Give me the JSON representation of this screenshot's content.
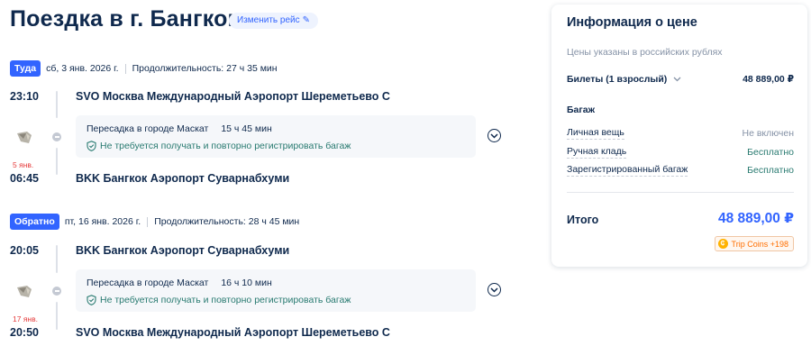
{
  "title": "Поездка в г. Бангкок",
  "change_label": "Изменить рейс",
  "outbound": {
    "badge": "Туда",
    "date": "сб, 3 янв. 2026 г.",
    "duration": "Продолжительность: 27 ч 35 мин",
    "depart_time": "23:10",
    "depart_airport": "SVO Москва Международный Аэропорт Шереметьево C",
    "transfer_city": "Пересадка в городе Маскат",
    "transfer_duration": "15 ч 45 мин",
    "baggage_note": "Не требуется получать и повторно регистрировать багаж",
    "arrive_day": "5 янв.",
    "arrive_time": "06:45",
    "arrive_airport": "BKK Бангкок Аэропорт Суварнабхуми"
  },
  "return": {
    "badge": "Обратно",
    "date": "пт, 16 янв. 2026 г.",
    "duration": "Продолжительность: 28 ч 45 мин",
    "depart_time": "20:05",
    "depart_airport": "BKK Бангкок Аэропорт Суварнабхуми",
    "transfer_city": "Пересадка в городе Маскат",
    "transfer_duration": "16 ч 10 мин",
    "baggage_note": "Не требуется получать и повторно регистрировать багаж",
    "arrive_day": "17 янв.",
    "arrive_time": "20:50",
    "arrive_airport": "SVO Москва Международный Аэропорт Шереметьево C"
  },
  "price": {
    "title": "Информация о цене",
    "currency_note": "Цены указаны в российских рублях",
    "tickets_label": "Билеты (1 взрослый)",
    "tickets_value": "48 889,00 ₽",
    "baggage_title": "Багаж",
    "items": [
      {
        "label": "Личная вещь",
        "value": "Не включен"
      },
      {
        "label": "Ручная кладь",
        "value": "Бесплатно"
      },
      {
        "label": "Зарегистрированный багаж",
        "value": "Бесплатно"
      }
    ],
    "total_label": "Итого",
    "total_value": "48 889,00 ₽",
    "coins": "Trip Coins +198"
  },
  "colors": {
    "accent": "#3264ff",
    "text": "#0f294d",
    "green": "#287a70",
    "red": "#e53c3c"
  },
  "icons": [
    "pencil-icon",
    "shield-check-icon",
    "chevron-down-icon",
    "airline-logo",
    "coin-icon"
  ]
}
